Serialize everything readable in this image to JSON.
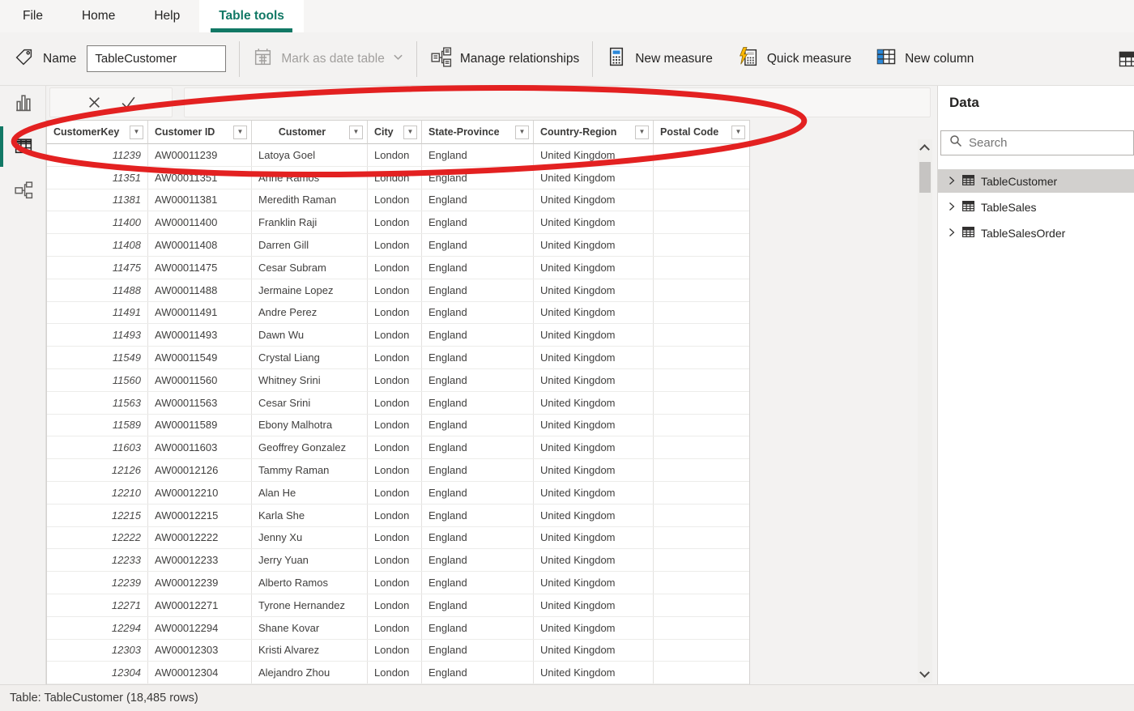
{
  "tabs": [
    {
      "label": "File"
    },
    {
      "label": "Home"
    },
    {
      "label": "Help"
    },
    {
      "label": "Table tools",
      "selected": true
    }
  ],
  "ribbon": {
    "name_label": "Name",
    "name_value": "TableCustomer",
    "mark_as_date_table_label": "Mark as date table",
    "manage_relationships_label": "Manage relationships",
    "new_measure_label": "New measure",
    "quick_measure_label": "Quick measure",
    "new_column_label": "New column"
  },
  "icons": {
    "filter_dropdown_glyph": "▼"
  },
  "table": {
    "columns": [
      {
        "label": "CustomerKey"
      },
      {
        "label": "Customer ID"
      },
      {
        "label": "Customer"
      },
      {
        "label": "City"
      },
      {
        "label": "State-Province"
      },
      {
        "label": "Country-Region"
      },
      {
        "label": "Postal Code"
      }
    ],
    "rows": [
      {
        "key": "11239",
        "id": "AW00011239",
        "name": "Latoya Goel",
        "city": "London",
        "state": "England",
        "country": "United Kingdom",
        "postal": ""
      },
      {
        "key": "11351",
        "id": "AW00011351",
        "name": "Anne Ramos",
        "city": "London",
        "state": "England",
        "country": "United Kingdom",
        "postal": ""
      },
      {
        "key": "11381",
        "id": "AW00011381",
        "name": "Meredith Raman",
        "city": "London",
        "state": "England",
        "country": "United Kingdom",
        "postal": ""
      },
      {
        "key": "11400",
        "id": "AW00011400",
        "name": "Franklin Raji",
        "city": "London",
        "state": "England",
        "country": "United Kingdom",
        "postal": ""
      },
      {
        "key": "11408",
        "id": "AW00011408",
        "name": "Darren Gill",
        "city": "London",
        "state": "England",
        "country": "United Kingdom",
        "postal": ""
      },
      {
        "key": "11475",
        "id": "AW00011475",
        "name": "Cesar Subram",
        "city": "London",
        "state": "England",
        "country": "United Kingdom",
        "postal": ""
      },
      {
        "key": "11488",
        "id": "AW00011488",
        "name": "Jermaine Lopez",
        "city": "London",
        "state": "England",
        "country": "United Kingdom",
        "postal": ""
      },
      {
        "key": "11491",
        "id": "AW00011491",
        "name": "Andre Perez",
        "city": "London",
        "state": "England",
        "country": "United Kingdom",
        "postal": ""
      },
      {
        "key": "11493",
        "id": "AW00011493",
        "name": "Dawn Wu",
        "city": "London",
        "state": "England",
        "country": "United Kingdom",
        "postal": ""
      },
      {
        "key": "11549",
        "id": "AW00011549",
        "name": "Crystal Liang",
        "city": "London",
        "state": "England",
        "country": "United Kingdom",
        "postal": ""
      },
      {
        "key": "11560",
        "id": "AW00011560",
        "name": "Whitney Srini",
        "city": "London",
        "state": "England",
        "country": "United Kingdom",
        "postal": ""
      },
      {
        "key": "11563",
        "id": "AW00011563",
        "name": "Cesar Srini",
        "city": "London",
        "state": "England",
        "country": "United Kingdom",
        "postal": ""
      },
      {
        "key": "11589",
        "id": "AW00011589",
        "name": "Ebony Malhotra",
        "city": "London",
        "state": "England",
        "country": "United Kingdom",
        "postal": ""
      },
      {
        "key": "11603",
        "id": "AW00011603",
        "name": "Geoffrey Gonzalez",
        "city": "London",
        "state": "England",
        "country": "United Kingdom",
        "postal": ""
      },
      {
        "key": "12126",
        "id": "AW00012126",
        "name": "Tammy Raman",
        "city": "London",
        "state": "England",
        "country": "United Kingdom",
        "postal": ""
      },
      {
        "key": "12210",
        "id": "AW00012210",
        "name": "Alan He",
        "city": "London",
        "state": "England",
        "country": "United Kingdom",
        "postal": ""
      },
      {
        "key": "12215",
        "id": "AW00012215",
        "name": "Karla She",
        "city": "London",
        "state": "England",
        "country": "United Kingdom",
        "postal": ""
      },
      {
        "key": "12222",
        "id": "AW00012222",
        "name": "Jenny Xu",
        "city": "London",
        "state": "England",
        "country": "United Kingdom",
        "postal": ""
      },
      {
        "key": "12233",
        "id": "AW00012233",
        "name": "Jerry Yuan",
        "city": "London",
        "state": "England",
        "country": "United Kingdom",
        "postal": ""
      },
      {
        "key": "12239",
        "id": "AW00012239",
        "name": "Alberto Ramos",
        "city": "London",
        "state": "England",
        "country": "United Kingdom",
        "postal": ""
      },
      {
        "key": "12271",
        "id": "AW00012271",
        "name": "Tyrone Hernandez",
        "city": "London",
        "state": "England",
        "country": "United Kingdom",
        "postal": ""
      },
      {
        "key": "12294",
        "id": "AW00012294",
        "name": "Shane Kovar",
        "city": "London",
        "state": "England",
        "country": "United Kingdom",
        "postal": ""
      },
      {
        "key": "12303",
        "id": "AW00012303",
        "name": "Kristi Alvarez",
        "city": "London",
        "state": "England",
        "country": "United Kingdom",
        "postal": ""
      },
      {
        "key": "12304",
        "id": "AW00012304",
        "name": "Alejandro Zhou",
        "city": "London",
        "state": "England",
        "country": "United Kingdom",
        "postal": ""
      }
    ]
  },
  "data_panel": {
    "title": "Data",
    "search_placeholder": "Search",
    "tables": [
      {
        "label": "TableCustomer",
        "selected": true
      },
      {
        "label": "TableSales"
      },
      {
        "label": "TableSalesOrder"
      }
    ]
  },
  "status_bar": {
    "text": "Table: TableCustomer (18,485 rows)"
  },
  "annotation": {
    "type": "ellipse",
    "color": "#e32121",
    "target": "table header row"
  },
  "colors": {
    "accent": "#117865",
    "ribbon_bg": "#f3f2f1",
    "selected_item_bg": "#d2d0ce",
    "new_column_blue": "#2b88d8",
    "quick_measure_bolt": "#ffb900"
  }
}
